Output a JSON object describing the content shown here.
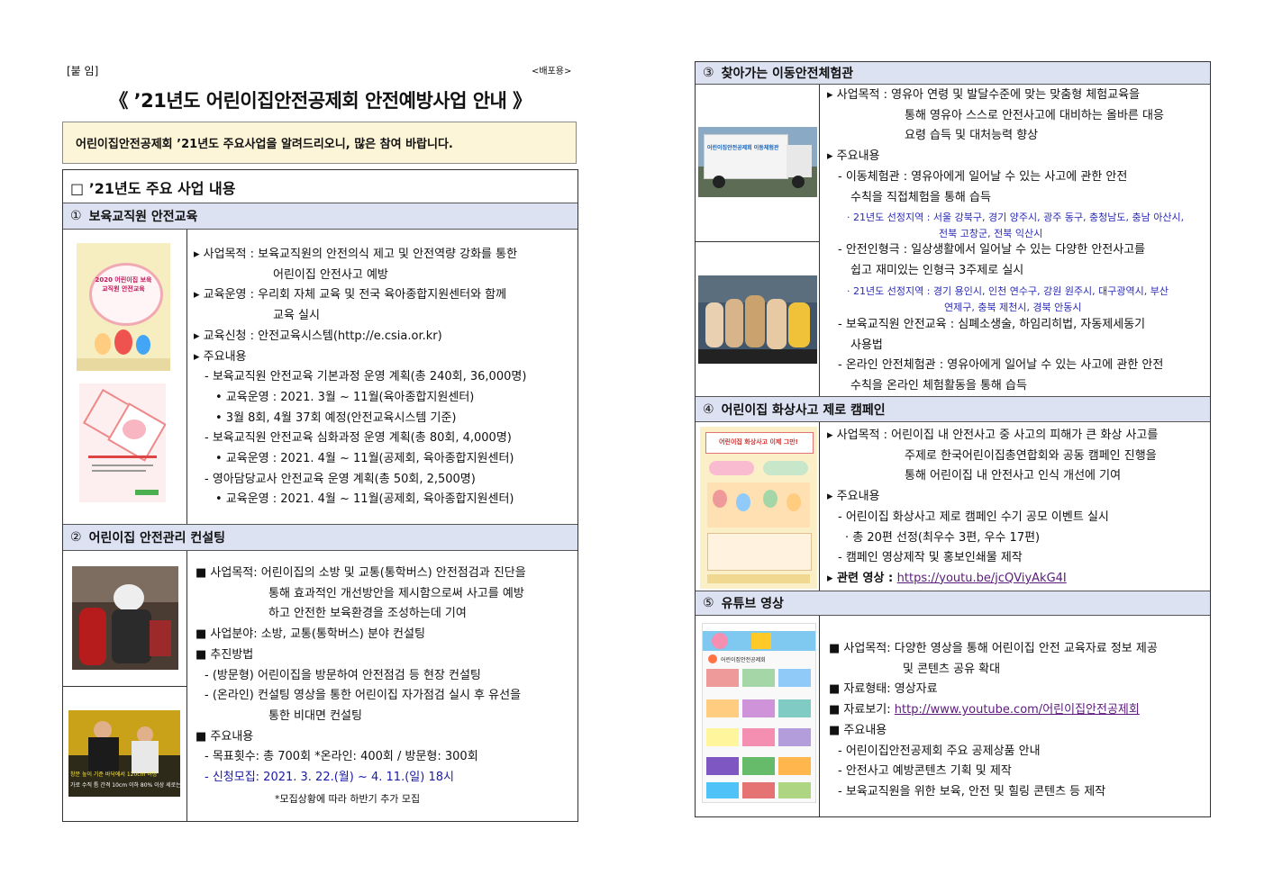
{
  "header": {
    "attach_label": "[붙 임]",
    "distribution": "<배포용>",
    "title": "《 ’21년도 어린이집안전공제회 안전예방사업 안내 》",
    "notice": "어린이집안전공제회 ’21년도 주요사업을 알려드리오니, 많은 참여 바랍니다."
  },
  "left": {
    "box_title": "□ ’21년도 주요 사업 내용",
    "sec1": {
      "num": "①",
      "title": "보육교직원 안전교육",
      "book_title": "2020 어린이집 보육교직원 안전교육",
      "book_lines": [
        "▸ 사업목적 : 보육교직원의 안전의식 제고 및 안전역량 강화를 통한",
        "어린이집 안전사고 예방",
        "▸ 교육운영 : 우리회 자체 교육 및 전국 육아종합지원센터와 함께",
        "교육 실시",
        "▸ 교육신청 : 안전교육시스템(http://e.csia.or.kr)",
        "▸ 주요내용",
        "- 보육교직원 안전교육 기본과정 운영 계획(총 240회, 36,000명)",
        "• 교육운영 : 2021. 3월 ~ 11월(육아종합지원센터)",
        "• 3월 8회, 4월 37회 예정(안전교육시스템 기준)",
        "- 보육교직원 안전교육 심화과정 운영 계획(총 80회, 4,000명)",
        "• 교육운영 : 2021. 4월 ~ 11월(공제회, 육아종합지원센터)",
        "- 영아담당교사 안전교육 운영 계획(총 50회, 2,500명)",
        "• 교육운영 : 2021. 4월 ~ 11월(공제회, 육아종합지원센터)"
      ]
    },
    "sec2": {
      "num": "②",
      "title": "어린이집 안전관리 컨설팅",
      "img_caption_1": "창문 높이 기준 바닥에서 120cm 이상",
      "img_caption_2": "가로 수직 틈 간격 10cm 이하 80% 이상  세로는 20cm 이상",
      "lines": [
        "■ 사업목적: 어린이집의 소방 및 교통(통학버스) 안전점검과 진단을",
        "통해 효과적인 개선방안을 제시함으로써 사고를 예방",
        "하고 안전한 보육환경을 조성하는데 기여",
        "■ 사업분야: 소방, 교통(통학버스) 분야 컨설팅",
        "■ 추진방법",
        "- (방문형) 어린이집을 방문하여 안전점검 등 현장 컨설팅",
        "- (온라인) 컨설팅 영상을 통한 어린이집 자가점검 실시 후 유선을",
        "통한 비대면 컨설팅",
        "■ 주요내용",
        "- 목표횟수: 총 700회  *온라인: 400회 / 방문형: 300회",
        "- 신청모집: 2021. 3. 22.(월) ~ 4. 11.(일) 18시",
        "*모집상황에 따라 하반기 추가 모집"
      ]
    }
  },
  "right": {
    "sec3": {
      "num": "③",
      "title": "찾아가는 이동안전체험관",
      "truck_label": "어린이집안전공제회 이동체험관",
      "lines": [
        "▸ 사업목적 : 영유아 연령 및 발달수준에 맞는 맞춤형 체험교육을",
        "통해 영유아 스스로 안전사고에 대비하는 올바른 대응",
        "요령 습득 및 대처능력 향상",
        "▸ 주요내용",
        "- 이동체험관 : 영유아에게 일어날 수 있는 사고에 관한 안전",
        "수칙을 직접체험을 통해 습득",
        "· 21년도 선정지역 : 서울 강북구, 경기 양주시, 광주 동구, 충청남도, 충남 아산시,",
        "전북 고창군, 전북 익산시",
        "- 안전인형극 : 일상생활에서 일어날 수 있는 다양한 안전사고를",
        "쉽고 재미있는 인형극 3주제로 실시",
        "· 21년도 선정지역 : 경기 용인시, 인천 연수구, 강원 원주시, 대구광역시, 부산",
        "연제구, 충북 제천시, 경북 안동시",
        "- 보육교직원 안전교육 : 심폐소생술, 하임리히법, 자동제세동기",
        "사용법",
        "- 온라인 안전체험관 : 영유아에게 일어날 수 있는 사고에 관한 안전",
        "수칙을 온라인 체험활동을 통해 습득"
      ]
    },
    "sec4": {
      "num": "④",
      "title": "어린이집 화상사고 제로 캠페인",
      "poster_title": "어린이집 화상사고 이제 그만!",
      "lines": [
        "▸ 사업목적 : 어린이집 내 안전사고 중 사고의 피해가 큰 화상 사고를",
        "주제로 한국어린이집총연합회와 공동 캠페인 진행을",
        "통해 어린이집 내 안전사고 인식 개선에 기여",
        "▸ 주요내용",
        "- 어린이집 화상사고 제로 캠페인 수기 공모 이벤트 실시",
        "· 총 20편 선정(최우수 3편, 우수 17편)",
        "- 캠페인 영상제작 및 홍보인쇄물 제작",
        "▸ 관련 영상 : ",
        "https://youtu.be/jcQViyAkG4I"
      ]
    },
    "sec5": {
      "num": "⑤",
      "title": "유튜브 영상",
      "channel_name": "어린이집안전공제회",
      "lines": [
        "■ 사업목적: 다양한 영상을 통해 어린이집 안전 교육자료 정보 제공",
        "및 콘텐츠 공유 확대",
        "■ 자료형태: 영상자료",
        "■ 자료보기: ",
        "http://www.youtube.com/어린이집안전공제회",
        "■ 주요내용",
        "- 어린이집안전공제회 주요 공제상품 안내",
        "- 안전사고 예방콘텐츠 기획 및 제작",
        "- 보육교직원을 위한 보육, 안전 및 힐링 콘텐츠 등 제작"
      ]
    }
  },
  "colors": {
    "section_header": "#dde2f2",
    "notice_bg": "#fdf5d8",
    "blue_text": "#1a1aa8",
    "link": "#5a1a7a"
  }
}
